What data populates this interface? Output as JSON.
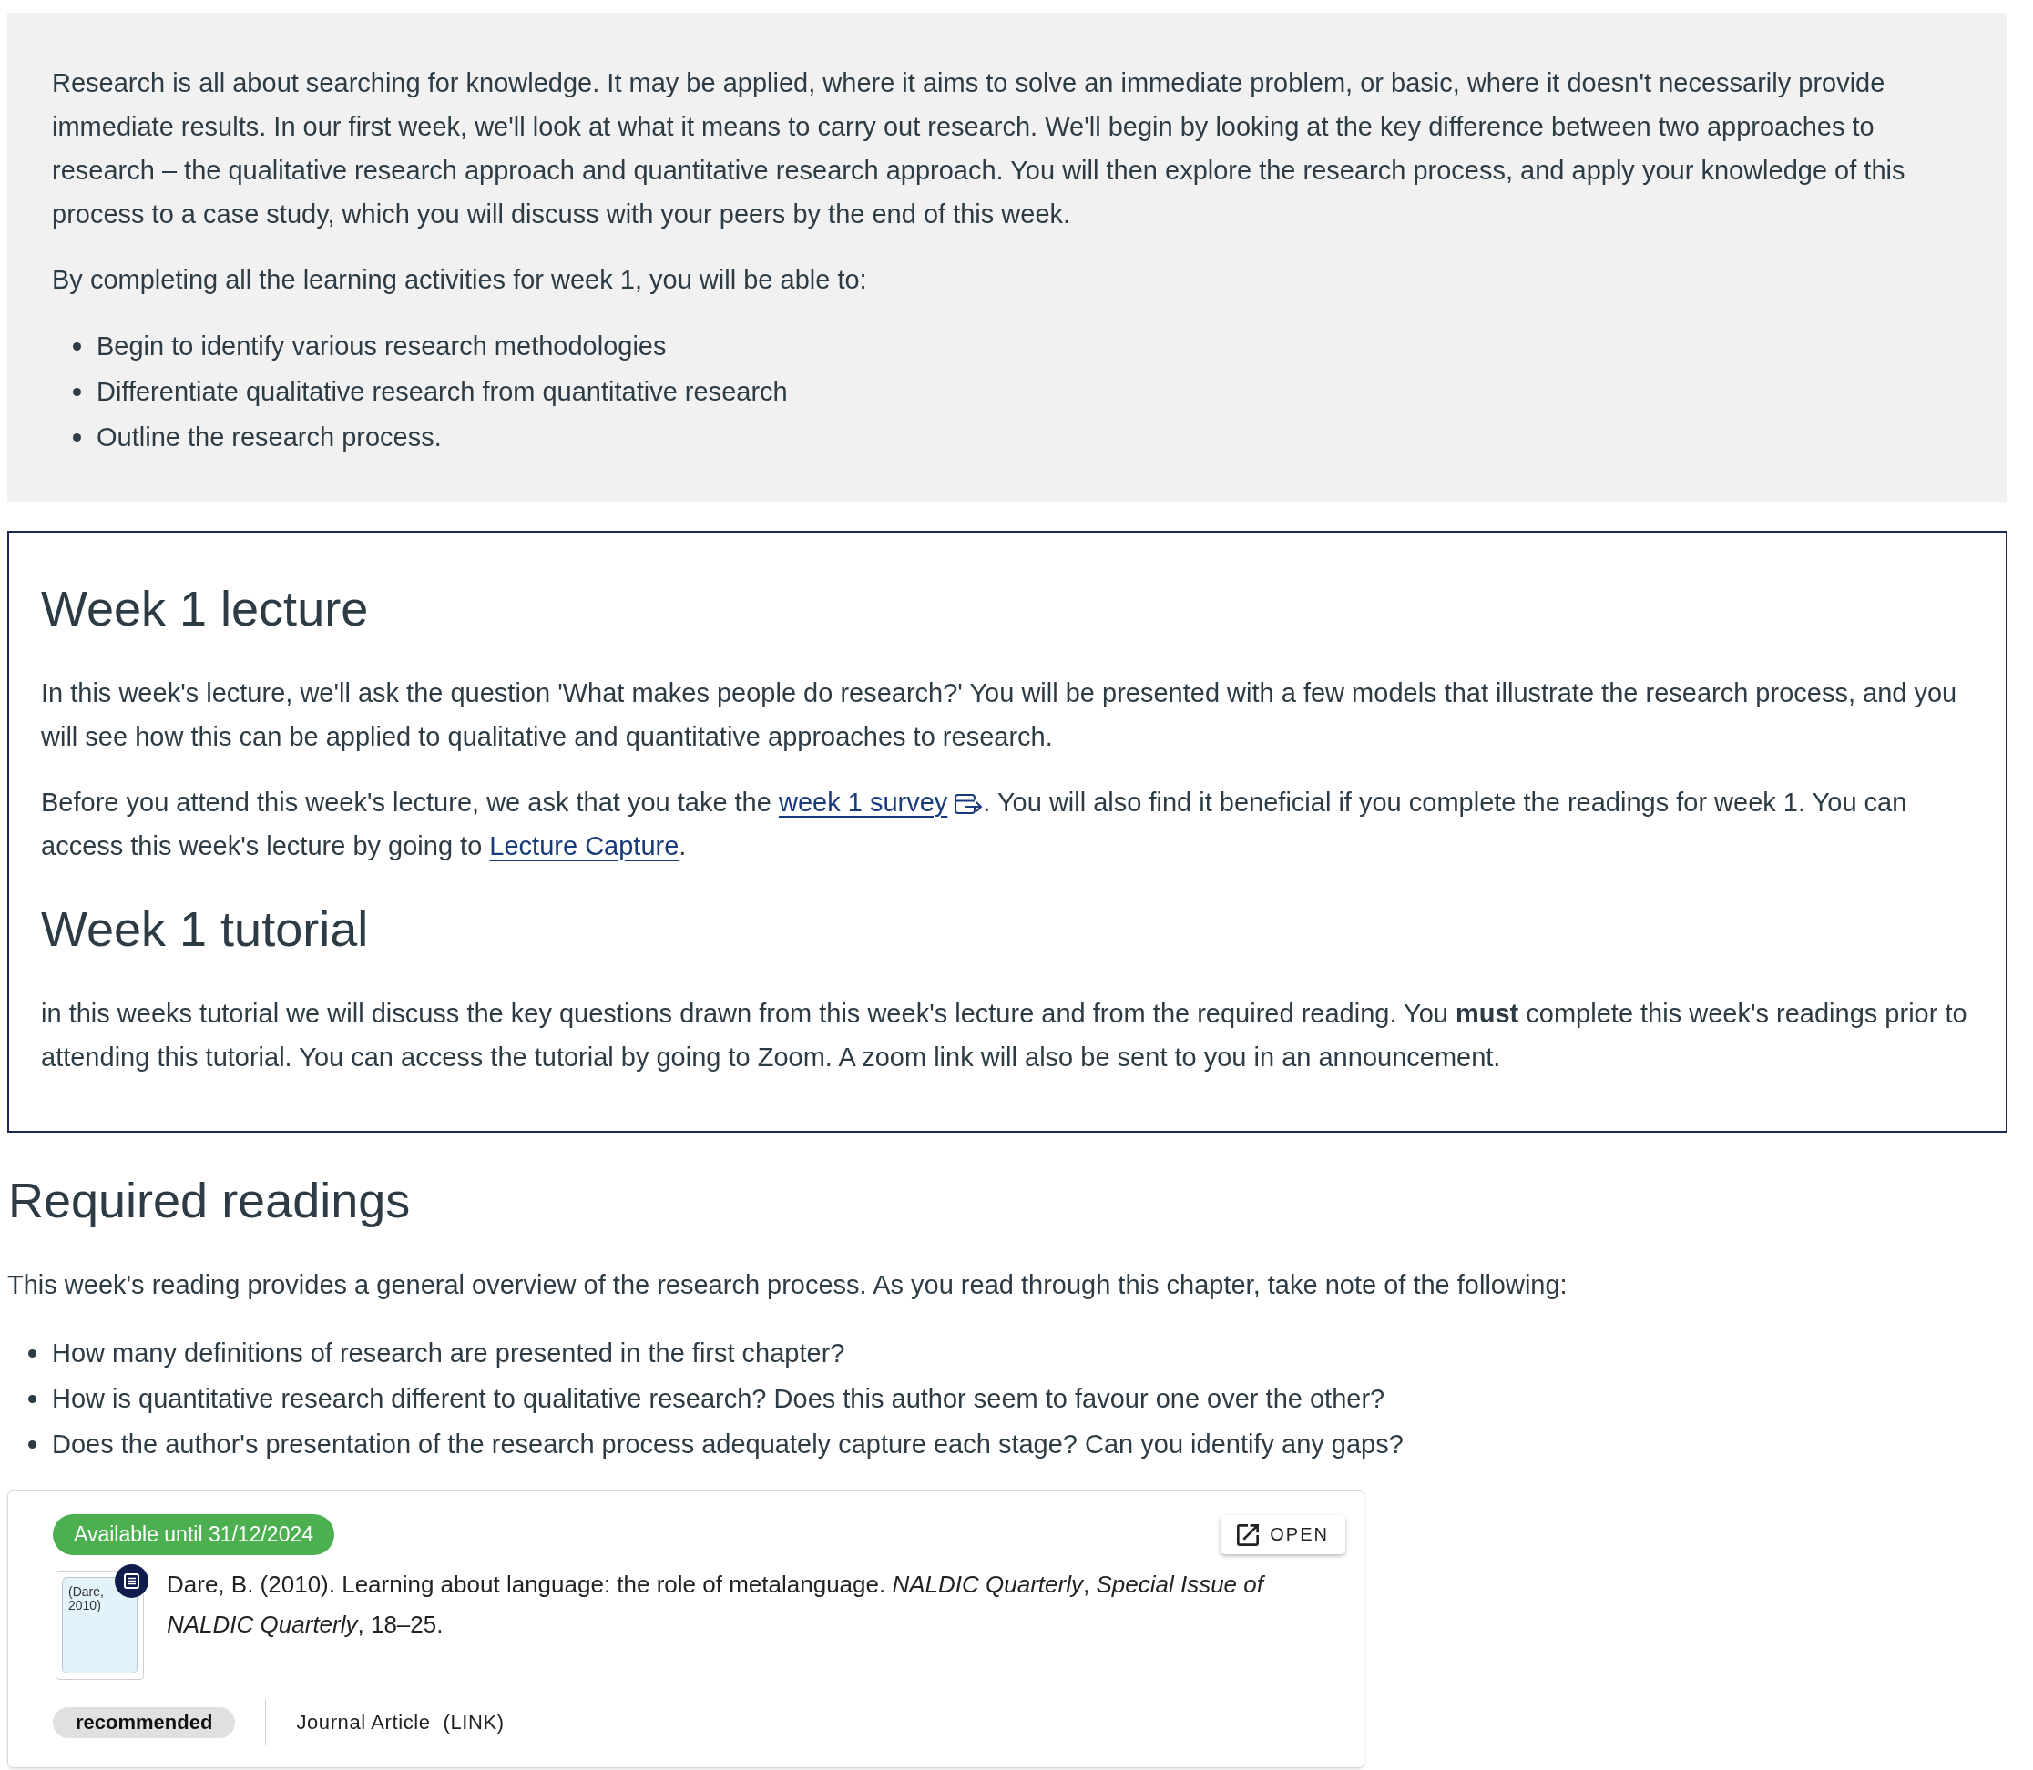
{
  "overview": {
    "paragraphs": [
      "Research is all about searching for knowledge. It may be applied, where it aims to solve an immediate problem, or basic, where it doesn't necessarily provide immediate results. In our first week, we'll look at what it means to carry out research. We'll begin by looking at the key difference between two approaches to research – the qualitative research approach and quantitative research approach. You will then explore the research process, and apply your knowledge of this process to a case study, which you will discuss with your peers by the end of this week.",
      "By completing all the learning activities for week 1, you will be able to:"
    ],
    "outcomes": [
      "Begin to identify various research methodologies",
      "Differentiate qualitative research from quantitative research",
      "Outline the research process."
    ]
  },
  "panel": {
    "sections": [
      {
        "heading": "Week 1 lecture",
        "paragraphs": [
          [
            {
              "kind": "text",
              "text": "In this week's lecture, we'll ask the question 'What makes people do research?' You will be presented with a few models that illustrate the research process, and you will see how this can be applied to qualitative and quantitative approaches to research."
            }
          ],
          [
            {
              "kind": "text",
              "text": "Before you attend this week's lecture, we ask that you take the "
            },
            {
              "kind": "external_link",
              "text": "week 1 survey"
            },
            {
              "kind": "text",
              "text": ". You will also find it beneficial if you complete the readings for week 1. You can access this week's lecture by going to "
            },
            {
              "kind": "link",
              "text": "Lecture Capture"
            },
            {
              "kind": "text",
              "text": "."
            }
          ]
        ]
      },
      {
        "heading": "Week 1 tutorial",
        "paragraphs": [
          [
            {
              "kind": "text",
              "text": "in this weeks tutorial we will discuss the key questions drawn from this week's lecture and from the required reading. You **must** complete this week's readings prior to attending this tutorial. You can access the tutorial by going to Zoom. A zoom link will also be sent to you in an announcement."
            }
          ]
        ]
      }
    ]
  },
  "readings": {
    "heading": "Required readings",
    "intro": "This week's reading provides a general overview of the research process. As you read through this chapter, take note of the following:",
    "questions": [
      "How many definitions of research are presented in the first chapter?",
      "How is quantitative research different to qualitative research? Does this author seem to favour one over the other?",
      "Does the author's presentation of the research process adequately capture each stage? Can you identify any gaps?"
    ],
    "items": [
      {
        "availability": "Available until 31/12/2024",
        "open_button": "OPEN",
        "cover_text": "(Dare, 2010)",
        "citation": "Dare, B. (2010). Learning about language: the role of metalanguage. *NALDIC Quarterly*, *Special Issue of NALDIC Quarterly*, 18–25.",
        "tag": "recommended",
        "type": "Journal Article",
        "source": "(LINK)"
      }
    ]
  }
}
